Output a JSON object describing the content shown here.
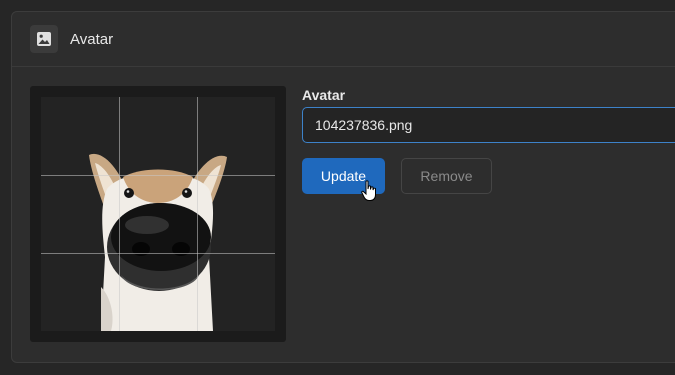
{
  "panel": {
    "title": "Avatar",
    "header_icon": "image-icon"
  },
  "avatar_form": {
    "field_label": "Avatar",
    "file_name": "104237836.png",
    "update_label": "Update",
    "remove_label": "Remove"
  },
  "colors": {
    "accent": "#1f69bd",
    "input_border": "#3d82c9"
  }
}
